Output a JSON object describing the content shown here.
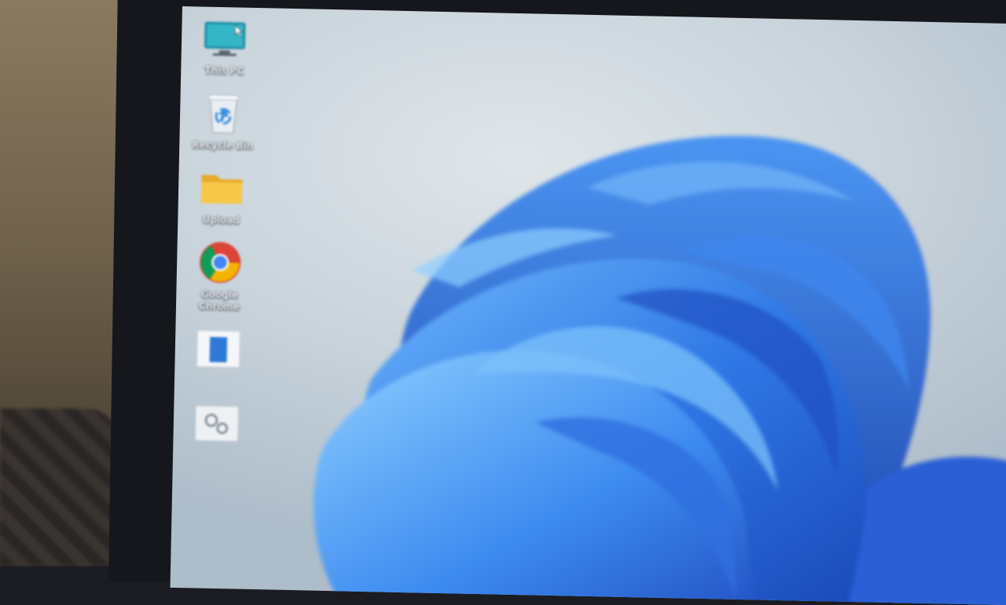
{
  "desktop": {
    "icons": [
      {
        "name": "this-pc",
        "label": "This PC",
        "icon": "monitor-icon"
      },
      {
        "name": "recycle-bin",
        "label": "Recycle Bin",
        "icon": "recycle-bin-icon"
      },
      {
        "name": "folder",
        "label": "Upload",
        "icon": "folder-icon"
      },
      {
        "name": "google-chrome",
        "label": "Google Chrome",
        "icon": "chrome-icon"
      },
      {
        "name": "app-shortcut",
        "label": "",
        "icon": "app-window-icon"
      },
      {
        "name": "app-shortcut-2",
        "label": "",
        "icon": "gears-icon"
      }
    ]
  },
  "colors": {
    "wallpaper_bg": "#c7d2da",
    "bloom_blue": "#2f6fe0",
    "bloom_light": "#5aa6f5",
    "folder_yellow": "#f6c84a",
    "monitor_teal": "#2aa0b8"
  }
}
